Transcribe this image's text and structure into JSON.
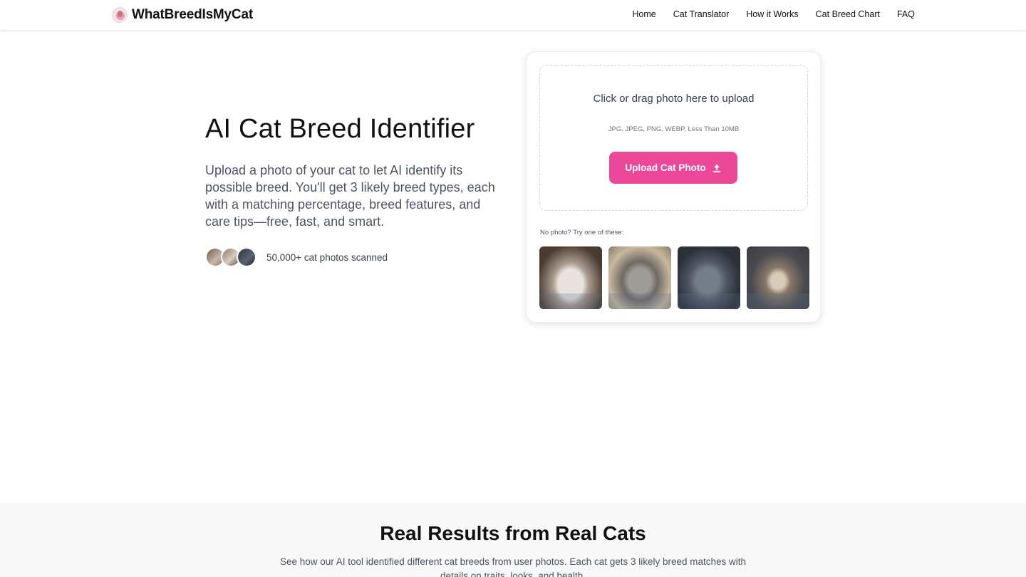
{
  "header": {
    "brand": "WhatBreedIsMyCat",
    "nav": [
      "Home",
      "Cat Translator",
      "How it Works",
      "Cat Breed Chart",
      "FAQ"
    ]
  },
  "hero": {
    "title": "AI Cat Breed Identifier",
    "description": "Upload a photo of your cat to let AI identify its possible breed. You'll get 3 likely breed types, each with a matching percentage, breed features, and care tips—free, fast, and smart.",
    "scanned": "50,000+ cat photos scanned"
  },
  "upload": {
    "title": "Click or drag photo here to upload",
    "formats": "JPG, JPEG, PNG, WEBP, Less Than 10MB",
    "button": "Upload Cat Photo",
    "try_label": "No photo? Try one of these:"
  },
  "results": {
    "title": "Real Results from Real Cats",
    "description": "See how our AI tool identified different cat breeds from user photos. Each cat gets 3 likely breed matches with details on traits, looks, and health."
  },
  "colors": {
    "accent": "#ec4899",
    "section_bg": "#f7f8f7"
  }
}
